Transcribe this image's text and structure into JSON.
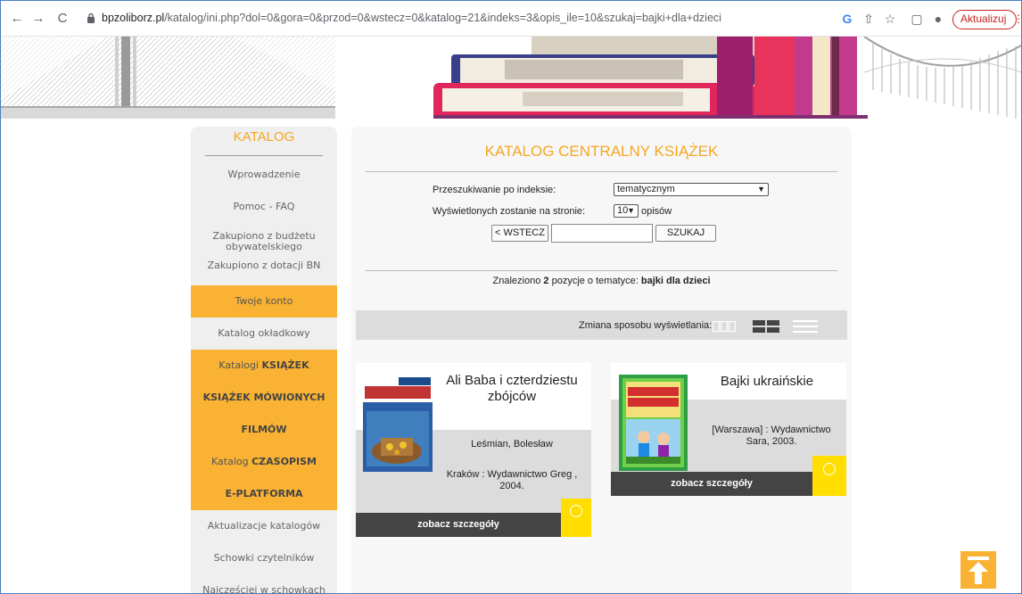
{
  "browser": {
    "url_host": "bpzoliborz.pl",
    "url_path": "/katalog/ini.php?dol=0&gora=0&przod=0&wstecz=0&katalog=21&indeks=3&opis_ile=10&szukaj=bajki+dla+dzieci",
    "update_label": "Aktualizuj"
  },
  "sidebar": {
    "title": "KATALOG",
    "items": [
      {
        "label": "Wprowadzenie"
      },
      {
        "label": "Pomoc - FAQ"
      },
      {
        "label": "Zakupiono z budżetu obywatelskiego"
      },
      {
        "label": "Zakupiono z dotacji BN"
      },
      {
        "label": "Twoje konto"
      },
      {
        "label": "Katalog okładkowy"
      },
      {
        "prefix": "Katalogi",
        "label": "KSIĄŻEK"
      },
      {
        "label": "KSIĄŻEK MÓWIONYCH"
      },
      {
        "label": "FILMÓW"
      },
      {
        "prefix": "Katalog",
        "label": "CZASOPISM"
      },
      {
        "label": "E-PLATFORMA"
      },
      {
        "label": "Aktualizacje katalogów"
      },
      {
        "label": "Schowki czytelników"
      },
      {
        "label": "Najczęściej w schowkach"
      }
    ]
  },
  "main": {
    "title": "KATALOG CENTRALNY KSIĄŻEK",
    "index_label": "Przeszukiwanie po indeksie:",
    "index_value": "tematycznym",
    "per_page_label": "Wyświetlonych zostanie na stronie:",
    "per_page_value": "10",
    "per_page_suffix": "opisów",
    "back_button": "< WSTECZ",
    "search_value": "",
    "search_button": "SZUKAJ",
    "found_prefix": "Znaleziono",
    "found_count": "2",
    "found_middle": "pozycje o tematyce:",
    "found_topic": "bajki dla dzieci",
    "view_label": "Zmiana sposobu wyświetlania:"
  },
  "results": [
    {
      "title": "Ali Baba i czterdziestu zbójców",
      "author": "Leśmian, Bolesław",
      "publisher": "Kraków : Wydawnictwo Greg , 2004.",
      "details_button": "zobacz szczegóły",
      "cover_title": "ALI BABA I CZTERDZIESTU ZBÓJCÓW",
      "cover_author": "Bolesław Leśmian"
    },
    {
      "title": "Bajki ukraińskie",
      "publisher": "[Warszawa] : Wydawnictwo Sara, 2003.",
      "details_button": "zobacz szczegóły",
      "cover_title": "BAJKI UKRAIŃSKIE"
    }
  ],
  "icons": {
    "smile": "smile-icon",
    "back_to_top": "arrow-up-icon",
    "view_grid3": "grid-three-icon",
    "view_grid4": "grid-four-icon",
    "view_list": "list-icon"
  },
  "colors": {
    "accent": "#f9b233",
    "title": "#f5a623",
    "yellow": "#ffde00",
    "footer": "#444444"
  }
}
